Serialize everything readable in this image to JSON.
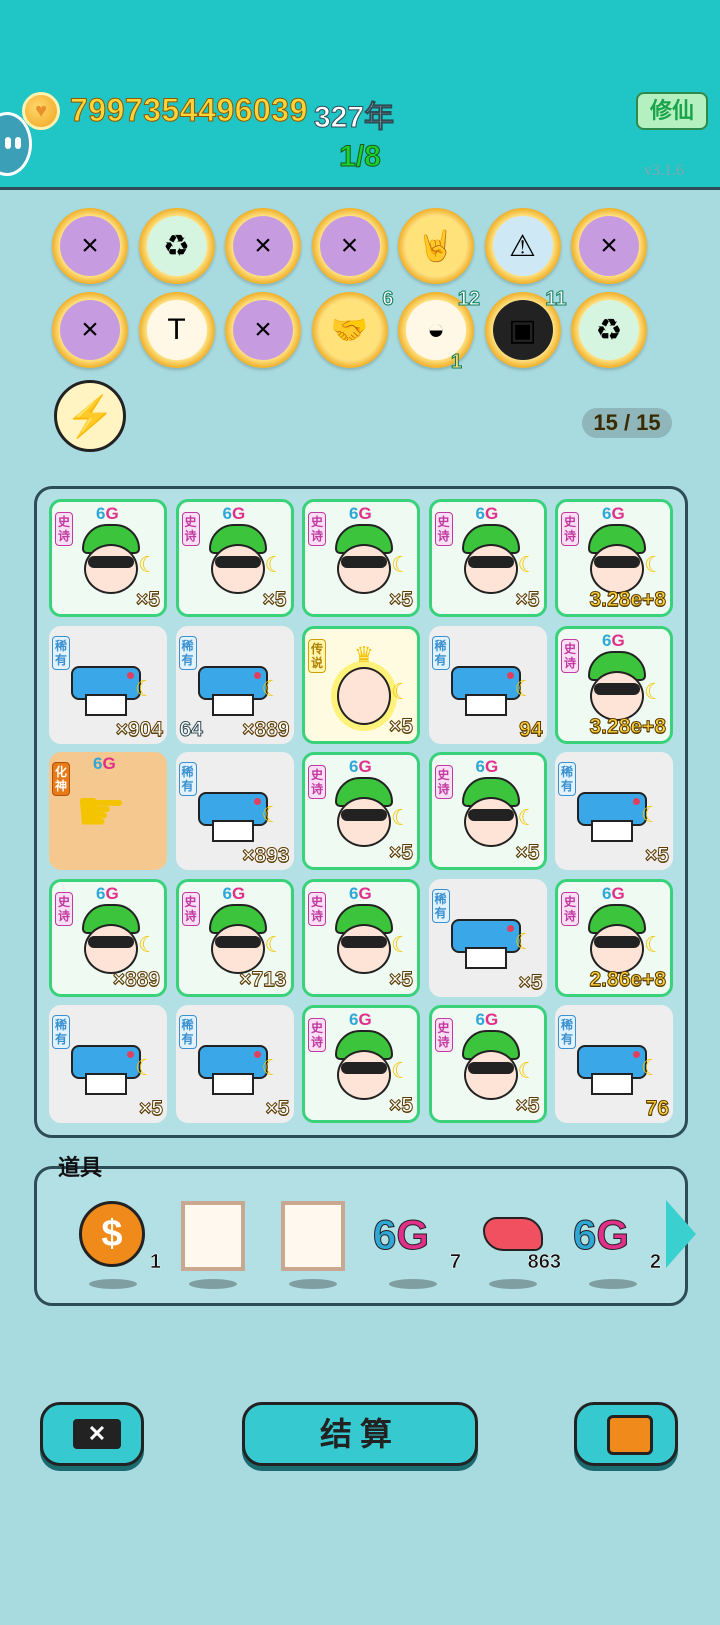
{
  "header": {
    "coins": "7997354496039",
    "years": "327年",
    "stage": "1/8",
    "cultivate_button": "修仙",
    "version": "v3.1.6"
  },
  "relics": {
    "row1": [
      {
        "icon": "math-formula-icon",
        "count": ""
      },
      {
        "icon": "recycle-icon",
        "count": ""
      },
      {
        "icon": "math-formula-icon",
        "count": ""
      },
      {
        "icon": "math-formula-icon",
        "count": ""
      },
      {
        "icon": "rock-hand-icon",
        "count": ""
      },
      {
        "icon": "printer-warning-icon",
        "count": ""
      },
      {
        "icon": "math-formula-icon",
        "count": ""
      }
    ],
    "row2": [
      {
        "icon": "math-formula-icon",
        "count": ""
      },
      {
        "icon": "time-magazine-icon",
        "count": ""
      },
      {
        "icon": "math-formula-icon",
        "count": ""
      },
      {
        "icon": "handshake-icon",
        "count": "6"
      },
      {
        "icon": "shell-icon",
        "count": "12",
        "sub": "1"
      },
      {
        "icon": "chip-icon",
        "count": "11"
      },
      {
        "icon": "recycle-icon",
        "count": ""
      }
    ]
  },
  "board_count": "15 / 15",
  "board": [
    [
      {
        "type": "face",
        "tag": "史诗",
        "g6": true,
        "value": "×5"
      },
      {
        "type": "face",
        "tag": "史诗",
        "g6": true,
        "value": "×5"
      },
      {
        "type": "face",
        "tag": "史诗",
        "g6": true,
        "value": "×5"
      },
      {
        "type": "face",
        "tag": "史诗",
        "g6": true,
        "value": "×5"
      },
      {
        "type": "face",
        "tag": "史诗",
        "g6": true,
        "value": "3.28e+8"
      }
    ],
    [
      {
        "type": "printer",
        "tag": "稀有",
        "value": "×904"
      },
      {
        "type": "printer",
        "tag": "稀有",
        "level": "64",
        "value": "×889"
      },
      {
        "type": "king",
        "tag": "传说",
        "value": "×5"
      },
      {
        "type": "printer",
        "tag": "稀有",
        "value": "94"
      },
      {
        "type": "face",
        "tag": "史诗",
        "g6": true,
        "value": "3.28e+8"
      }
    ],
    [
      {
        "type": "hand",
        "tag": "化神",
        "g6": true,
        "value": ""
      },
      {
        "type": "printer",
        "tag": "稀有",
        "value": "×893"
      },
      {
        "type": "face",
        "tag": "史诗",
        "g6": true,
        "value": "×5"
      },
      {
        "type": "face",
        "tag": "史诗",
        "g6": true,
        "value": "×5"
      },
      {
        "type": "printer",
        "tag": "稀有",
        "value": "×5"
      }
    ],
    [
      {
        "type": "face",
        "tag": "史诗",
        "g6": true,
        "value": "×889"
      },
      {
        "type": "face",
        "tag": "史诗",
        "g6": true,
        "value": "×713"
      },
      {
        "type": "face",
        "tag": "史诗",
        "g6": true,
        "value": "×5"
      },
      {
        "type": "printer",
        "tag": "稀有",
        "value": "×5"
      },
      {
        "type": "face",
        "tag": "史诗",
        "g6": true,
        "value": "2.86e+8"
      }
    ],
    [
      {
        "type": "printer",
        "tag": "稀有",
        "value": "×5"
      },
      {
        "type": "printer",
        "tag": "稀有",
        "value": "×5"
      },
      {
        "type": "face",
        "tag": "史诗",
        "g6": true,
        "value": "×5"
      },
      {
        "type": "face",
        "tag": "史诗",
        "g6": true,
        "value": "×5"
      },
      {
        "type": "printer",
        "tag": "稀有",
        "value": "76"
      }
    ]
  ],
  "items": {
    "label": "道具",
    "list": [
      {
        "icon": "dollar-coin-icon",
        "count": "1"
      },
      {
        "icon": "empty-frame-icon",
        "count": ""
      },
      {
        "icon": "empty-frame-icon",
        "count": ""
      },
      {
        "icon": "6g-icon",
        "count": "7"
      },
      {
        "icon": "liver-icon",
        "count": "863"
      },
      {
        "icon": "6g-icon",
        "count": "2"
      }
    ]
  },
  "buttons": {
    "settle": "结算"
  }
}
